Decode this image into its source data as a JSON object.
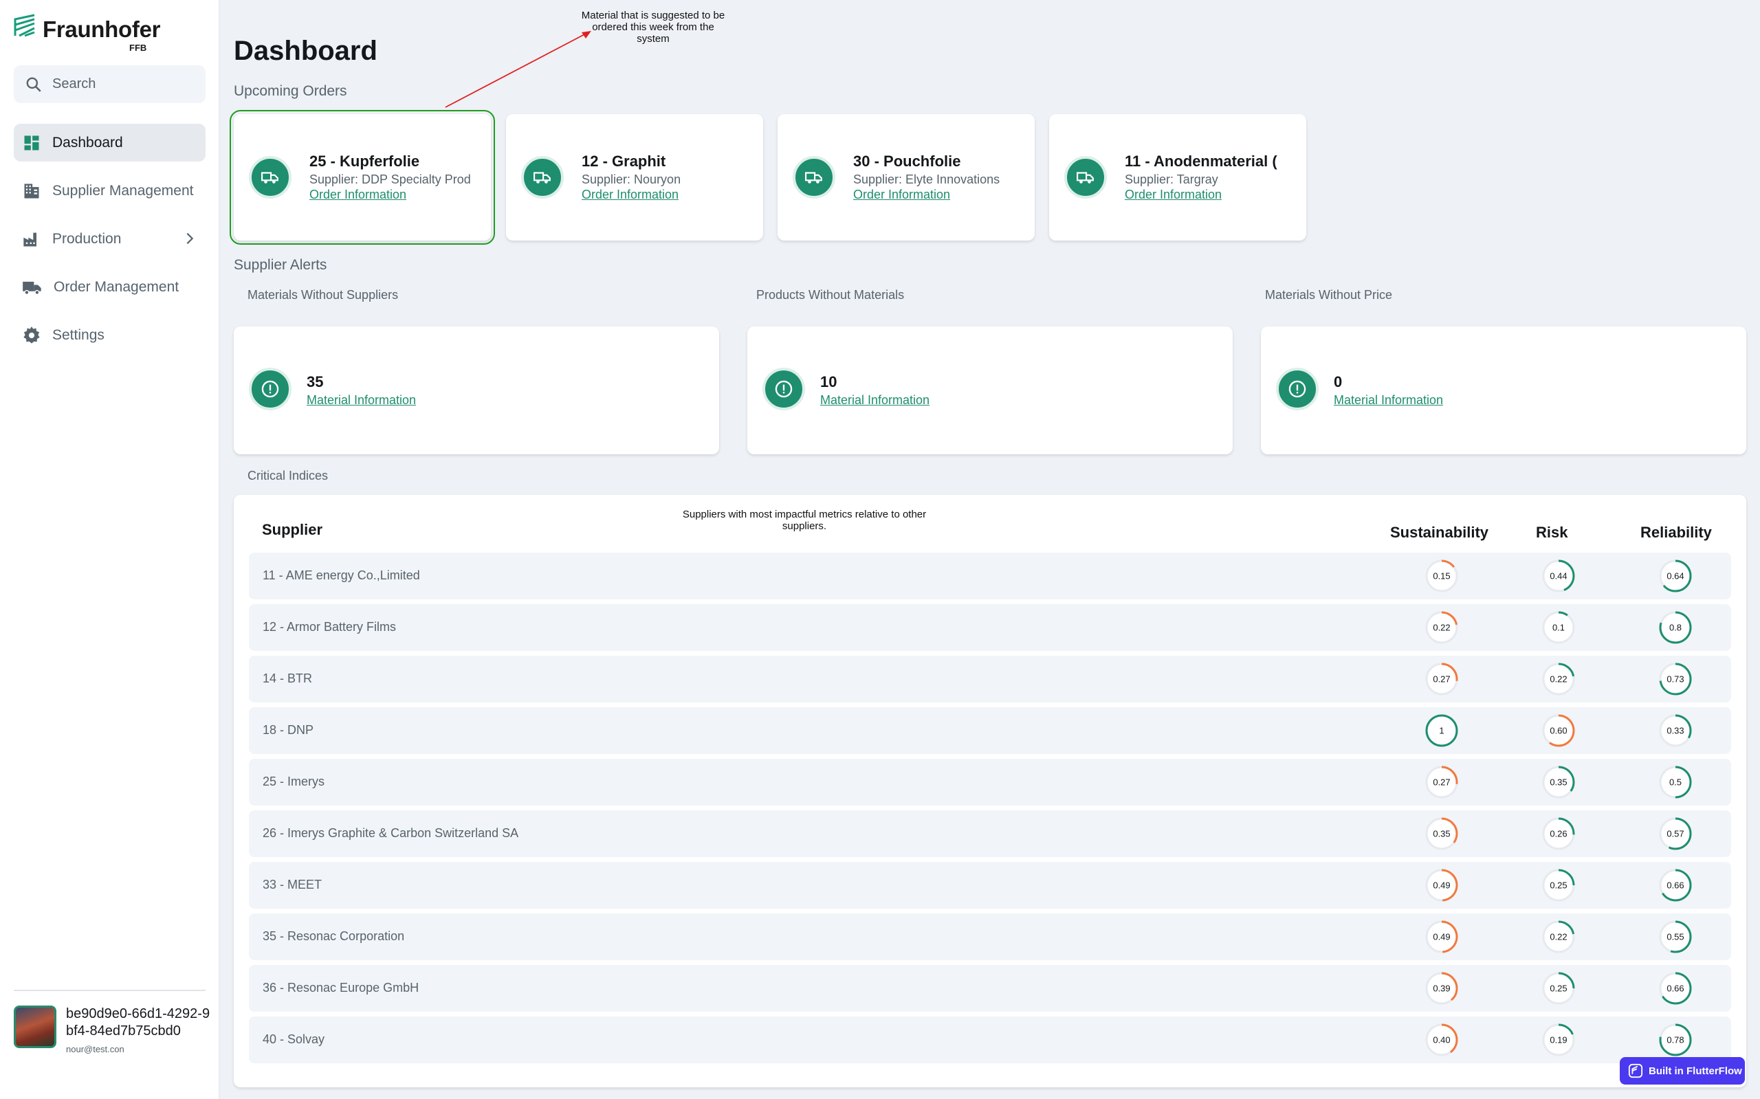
{
  "brand": {
    "name": "Fraunhofer",
    "sub": "FFB"
  },
  "search": {
    "label": "Search"
  },
  "nav": [
    {
      "label": "Dashboard",
      "icon": "dashboard-icon"
    },
    {
      "label": "Supplier Management",
      "icon": "building-icon"
    },
    {
      "label": "Production",
      "icon": "factory-icon"
    },
    {
      "label": "Order Management",
      "icon": "truck-icon"
    },
    {
      "label": "Settings",
      "icon": "gear-icon"
    }
  ],
  "user": {
    "id": "be90d9e0-66d1-4292-9bf4-84ed7b75cbd0",
    "email": "nour@test.con"
  },
  "page": {
    "title": "Dashboard"
  },
  "sections": {
    "upcoming": "Upcoming Orders",
    "alerts": "Supplier Alerts",
    "critical": "Critical Indices"
  },
  "annotations": {
    "orders": "Material that is suggested to be ordered this week from the system",
    "table": "Suppliers with most impactful metrics relative to other suppliers."
  },
  "orders": [
    {
      "title": "25 - Kupferfolie",
      "supplier": "Supplier: DDP Specialty Prod",
      "link": "Order Information"
    },
    {
      "title": "12 - Graphit",
      "supplier": "Supplier: Nouryon",
      "link": "Order Information"
    },
    {
      "title": "30 - Pouchfolie",
      "supplier": "Supplier: Elyte Innovations",
      "link": "Order Information"
    },
    {
      "title": "11 - Anodenmaterial (",
      "supplier": "Supplier: Targray",
      "link": "Order Information"
    }
  ],
  "alerts": [
    {
      "label": "Materials Without Suppliers",
      "count": "35",
      "link": "Material Information"
    },
    {
      "label": "Products Without Materials",
      "count": "10",
      "link": "Material Information"
    },
    {
      "label": "Materials Without Price",
      "count": "0",
      "link": "Material Information"
    }
  ],
  "table": {
    "headers": {
      "supplier": "Supplier",
      "sustainability": "Sustainability",
      "risk": "Risk",
      "reliability": "Reliability"
    },
    "rows": [
      {
        "supplier": "11 - AME energy Co.,Limited",
        "sustainability": "0.15",
        "risk": "0.44",
        "reliability": "0.64",
        "s": 0.15,
        "r": 0.44,
        "l": 0.64
      },
      {
        "supplier": "12 - Armor Battery Films",
        "sustainability": "0.22",
        "risk": "0.1",
        "reliability": "0.8",
        "s": 0.22,
        "r": 0.1,
        "l": 0.8
      },
      {
        "supplier": "14 - BTR",
        "sustainability": "0.27",
        "risk": "0.22",
        "reliability": "0.73",
        "s": 0.27,
        "r": 0.22,
        "l": 0.73
      },
      {
        "supplier": "18 - DNP",
        "sustainability": "1",
        "risk": "0.60",
        "reliability": "0.33",
        "s": 1,
        "r": 0.6,
        "l": 0.33
      },
      {
        "supplier": "25 - Imerys",
        "sustainability": "0.27",
        "risk": "0.35",
        "reliability": "0.5",
        "s": 0.27,
        "r": 0.35,
        "l": 0.5
      },
      {
        "supplier": "26 - Imerys Graphite & Carbon Switzerland SA",
        "sustainability": "0.35",
        "risk": "0.26",
        "reliability": "0.57",
        "s": 0.35,
        "r": 0.26,
        "l": 0.57
      },
      {
        "supplier": "33 - MEET",
        "sustainability": "0.49",
        "risk": "0.25",
        "reliability": "0.66",
        "s": 0.49,
        "r": 0.25,
        "l": 0.66
      },
      {
        "supplier": "35 - Resonac Corporation",
        "sustainability": "0.49",
        "risk": "0.22",
        "reliability": "0.55",
        "s": 0.49,
        "r": 0.22,
        "l": 0.55
      },
      {
        "supplier": "36 - Resonac Europe GmbH",
        "sustainability": "0.39",
        "risk": "0.25",
        "reliability": "0.66",
        "s": 0.39,
        "r": 0.25,
        "l": 0.66
      },
      {
        "supplier": "40 - Solvay",
        "sustainability": "0.40",
        "risk": "0.19",
        "reliability": "0.78",
        "s": 0.4,
        "r": 0.19,
        "l": 0.78
      }
    ]
  },
  "colors": {
    "accent": "#1e8e6e",
    "warn": "#f07a3f",
    "track": "#e6e9ee"
  },
  "badge": {
    "label": "Built in FlutterFlow"
  }
}
